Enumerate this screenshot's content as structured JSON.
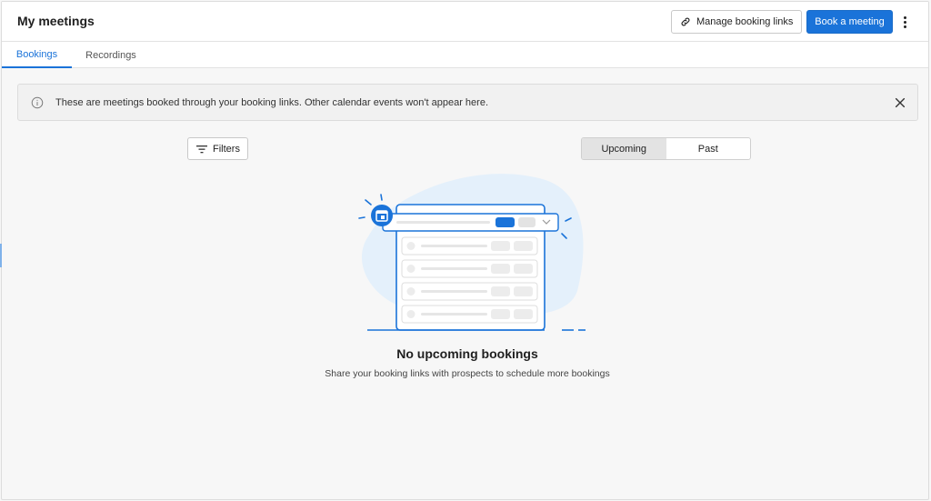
{
  "header": {
    "title": "My meetings",
    "manage_label": "Manage booking links",
    "book_label": "Book a meeting"
  },
  "tabs": [
    {
      "label": "Bookings",
      "active": true
    },
    {
      "label": "Recordings",
      "active": false
    }
  ],
  "banner": {
    "text": "These are meetings booked through your booking links. Other calendar events won't appear here."
  },
  "toolbar": {
    "filters_label": "Filters",
    "segments": [
      {
        "label": "Upcoming",
        "selected": true
      },
      {
        "label": "Past",
        "selected": false
      }
    ]
  },
  "empty_state": {
    "title": "No upcoming bookings",
    "subtitle": "Share your booking links with prospects to schedule more bookings"
  },
  "colors": {
    "accent": "#1a73d9",
    "illustration_blob": "#e4f0fb"
  },
  "icons": [
    "link-icon",
    "more-vertical-icon",
    "info-icon",
    "close-icon",
    "filter-icon",
    "calendar-icon",
    "chevron-down-icon"
  ]
}
